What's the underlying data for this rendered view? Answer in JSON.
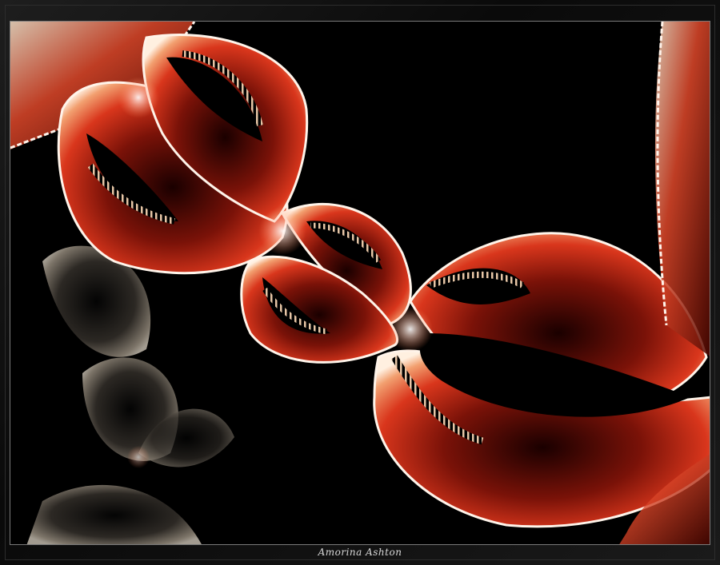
{
  "artwork": {
    "signature": "Amorina Ashton",
    "palette": {
      "background": "#000000",
      "frame": "#141414",
      "accent_red": "#e0301c",
      "accent_orange": "#f07a3a",
      "highlight": "#fff2e6",
      "ghost_grey": "#8c8478"
    }
  }
}
